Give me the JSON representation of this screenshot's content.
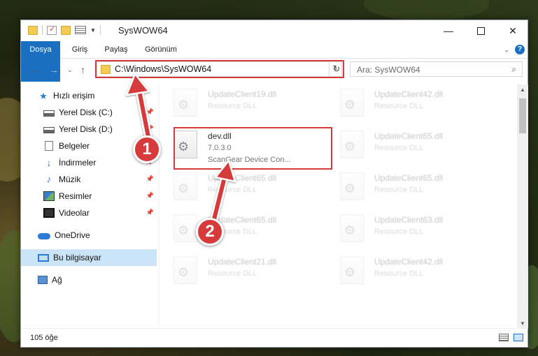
{
  "window": {
    "title": "SysWOW64"
  },
  "ribbon": {
    "tabs": [
      "Dosya",
      "Giriş",
      "Paylaş",
      "Görünüm"
    ]
  },
  "nav": {
    "address": "C:\\Windows\\SysWOW64",
    "search_placeholder": "Ara: SysWOW64"
  },
  "sidebar": {
    "items": [
      {
        "label": "Hızlı erişim",
        "icon": "star-icon"
      },
      {
        "label": "Yerel Disk (C:)",
        "icon": "drive-icon",
        "pinned": true
      },
      {
        "label": "Yerel Disk (D:)",
        "icon": "drive-icon",
        "pinned": true
      },
      {
        "label": "Belgeler",
        "icon": "document-icon",
        "pinned": true
      },
      {
        "label": "İndirmeler",
        "icon": "download-icon",
        "pinned": true
      },
      {
        "label": "Müzik",
        "icon": "music-icon",
        "pinned": true
      },
      {
        "label": "Resimler",
        "icon": "pictures-icon",
        "pinned": true
      },
      {
        "label": "Videolar",
        "icon": "videos-icon",
        "pinned": true
      },
      {
        "label": "OneDrive",
        "icon": "cloud-icon"
      },
      {
        "label": "Bu bilgisayar",
        "icon": "computer-icon",
        "selected": true
      },
      {
        "label": "Ağ",
        "icon": "network-icon"
      }
    ]
  },
  "files": [
    {
      "name": "UpdateClient19.dll",
      "type": "Resource DLL",
      "faded": true
    },
    {
      "name": "UpdateClient42.dll",
      "type": "Resource DLL",
      "faded": true
    },
    {
      "name": "dev.dll",
      "type": "7.0.3.0",
      "desc": "ScanGear Device Con...",
      "faded": false
    },
    {
      "name": "UpdateClient65.dll",
      "type": "Resource DLL",
      "faded": true
    },
    {
      "name": "UpdateClient65.dll",
      "type": "Resource DLL",
      "faded": true
    },
    {
      "name": "UpdateClient65.dll",
      "type": "Resource DLL",
      "faded": true
    },
    {
      "name": "UpdateClient65.dll",
      "type": "Resource DLL",
      "faded": true
    },
    {
      "name": "UpdateClient63.dll",
      "type": "Resource DLL",
      "faded": true
    },
    {
      "name": "UpdateClient21.dll",
      "type": "Resource DLL",
      "faded": true
    },
    {
      "name": "UpdateClient42.dll",
      "type": "Resource DLL",
      "faded": true
    }
  ],
  "status": {
    "item_count": "105 öğe"
  },
  "callouts": {
    "step1": "1",
    "step2": "2"
  },
  "colors": {
    "accent": "#1a6fc1",
    "highlight": "#d63a3a",
    "selected": "#cce4f7"
  }
}
